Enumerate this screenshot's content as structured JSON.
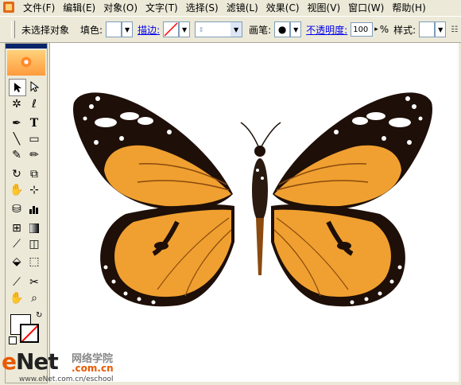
{
  "menu": [
    "文件(F)",
    "编辑(E)",
    "对象(O)",
    "文字(T)",
    "选择(S)",
    "滤镜(L)",
    "效果(C)",
    "视图(V)",
    "窗口(W)",
    "帮助(H)"
  ],
  "control": {
    "status": "未选择对象",
    "fill_label": "填色:",
    "stroke_link": "描边:",
    "brush_label": "画笔:",
    "opacity_link": "不透明度:",
    "opacity_value": "100",
    "percent": "%",
    "style_label": "样式:"
  },
  "watermark": {
    "enet_e": "e",
    "enet_rest": "Net",
    "cn": "网络学院",
    "com": ".com.cn",
    "url": "www.eNet.com.cn/eschool"
  },
  "colors": {
    "wing_orange": "#f0a030",
    "wing_dark": "#1e0f08"
  },
  "icons": [
    "selection-tool-icon",
    "direct-selection-icon",
    "magic-wand-icon",
    "lasso-icon",
    "pen-icon",
    "type-icon",
    "line-icon",
    "rectangle-icon",
    "paintbrush-icon",
    "pencil-icon",
    "rotate-icon",
    "scale-icon",
    "warp-icon",
    "free-transform-icon",
    "symbol-sprayer-icon",
    "column-graph-icon",
    "mesh-icon",
    "gradient-icon",
    "eyedropper-icon",
    "blend-icon",
    "live-paint-icon",
    "live-paint-select-icon",
    "slice-icon",
    "scissors-icon",
    "hand-icon",
    "zoom-icon"
  ]
}
